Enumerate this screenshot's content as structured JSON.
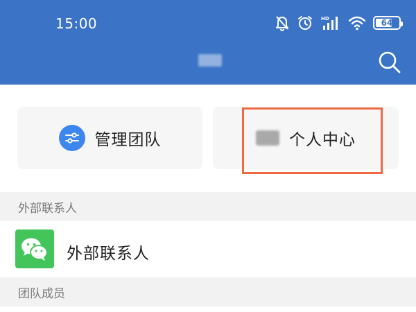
{
  "status_bar": {
    "time": "15:00",
    "icons": [
      "mute-bell-icon",
      "alarm-icon",
      "hd-signal-icon",
      "wifi-icon",
      "battery-icon"
    ],
    "battery_level": "64"
  },
  "header": {
    "title_redacted": true,
    "search_icon": "search-icon"
  },
  "cards": {
    "manage_team_label": "管理团队",
    "personal_center_label": "个人中心"
  },
  "sections": {
    "external_contacts_header": "外部联系人",
    "team_members_header": "团队成员"
  },
  "contacts": {
    "external_contact_label": "外部联系人"
  },
  "colors": {
    "header_bg": "#3b73c6",
    "team_icon_bg": "#3d86ee",
    "wechat_green": "#44c55b",
    "highlight": "#ee6a43"
  }
}
